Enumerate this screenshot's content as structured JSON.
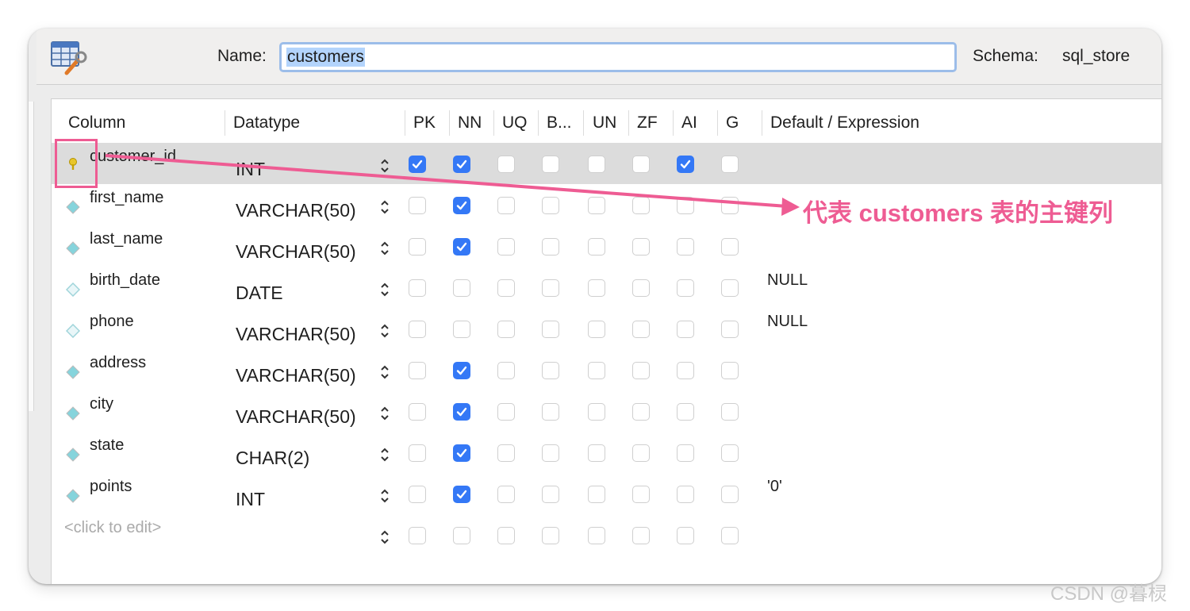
{
  "header": {
    "name_label": "Name:",
    "name_value": "customers",
    "schema_label": "Schema:",
    "schema_value": "sql_store"
  },
  "grid": {
    "columns": [
      "Column",
      "Datatype",
      "PK",
      "NN",
      "UQ",
      "B...",
      "UN",
      "ZF",
      "AI",
      "G",
      "Default / Expression"
    ],
    "rows": [
      {
        "name": "customer_id",
        "type": "INT",
        "icon": "primary-key-icon",
        "flags": [
          true,
          true,
          false,
          false,
          false,
          false,
          true,
          false
        ],
        "default": ""
      },
      {
        "name": "first_name",
        "type": "VARCHAR(50)",
        "icon": "column-diamond-filled-icon",
        "flags": [
          false,
          true,
          false,
          false,
          false,
          false,
          false,
          false
        ],
        "default": ""
      },
      {
        "name": "last_name",
        "type": "VARCHAR(50)",
        "icon": "column-diamond-filled-icon",
        "flags": [
          false,
          true,
          false,
          false,
          false,
          false,
          false,
          false
        ],
        "default": ""
      },
      {
        "name": "birth_date",
        "type": "DATE",
        "icon": "column-diamond-outline-icon",
        "flags": [
          false,
          false,
          false,
          false,
          false,
          false,
          false,
          false
        ],
        "default": "NULL"
      },
      {
        "name": "phone",
        "type": "VARCHAR(50)",
        "icon": "column-diamond-outline-icon",
        "flags": [
          false,
          false,
          false,
          false,
          false,
          false,
          false,
          false
        ],
        "default": "NULL"
      },
      {
        "name": "address",
        "type": "VARCHAR(50)",
        "icon": "column-diamond-filled-icon",
        "flags": [
          false,
          true,
          false,
          false,
          false,
          false,
          false,
          false
        ],
        "default": ""
      },
      {
        "name": "city",
        "type": "VARCHAR(50)",
        "icon": "column-diamond-filled-icon",
        "flags": [
          false,
          true,
          false,
          false,
          false,
          false,
          false,
          false
        ],
        "default": ""
      },
      {
        "name": "state",
        "type": "CHAR(2)",
        "icon": "column-diamond-filled-icon",
        "flags": [
          false,
          true,
          false,
          false,
          false,
          false,
          false,
          false
        ],
        "default": ""
      },
      {
        "name": "points",
        "type": "INT",
        "icon": "column-diamond-filled-icon",
        "flags": [
          false,
          true,
          false,
          false,
          false,
          false,
          false,
          false
        ],
        "default": "'0'"
      }
    ],
    "new_row_placeholder": "<click to edit>",
    "new_row_flags": [
      false,
      false,
      false,
      false,
      false,
      false,
      false,
      false
    ]
  },
  "annotation": {
    "text": "代表 customers 表的主键列",
    "color": "#ee5c93"
  },
  "watermark": "CSDN @暮棂",
  "colors": {
    "checkbox_on": "#3478f6",
    "selected_row": "#dcdcdc",
    "highlight_box": "#ee5c93"
  }
}
